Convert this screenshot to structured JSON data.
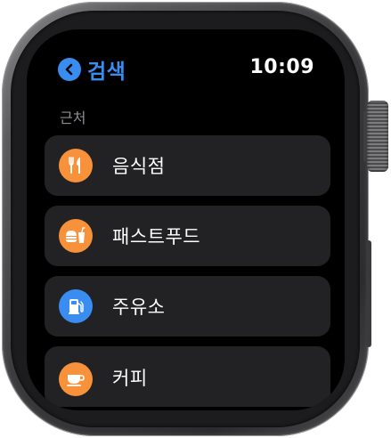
{
  "header": {
    "back_label": "검색",
    "time": "10:09"
  },
  "section": {
    "title": "근처"
  },
  "categories": [
    {
      "label": "음식점",
      "icon": "fork-knife-icon",
      "color": "#f7923a"
    },
    {
      "label": "패스트푸드",
      "icon": "burger-drink-icon",
      "color": "#f7923a"
    },
    {
      "label": "주유소",
      "icon": "fuel-pump-icon",
      "color": "#3a8df0"
    },
    {
      "label": "커피",
      "icon": "coffee-cup-icon",
      "color": "#f7923a"
    }
  ],
  "colors": {
    "accent_blue": "#3a8df0",
    "accent_orange": "#f7923a",
    "row_background": "#222224",
    "secondary_text": "#8e8e93"
  }
}
